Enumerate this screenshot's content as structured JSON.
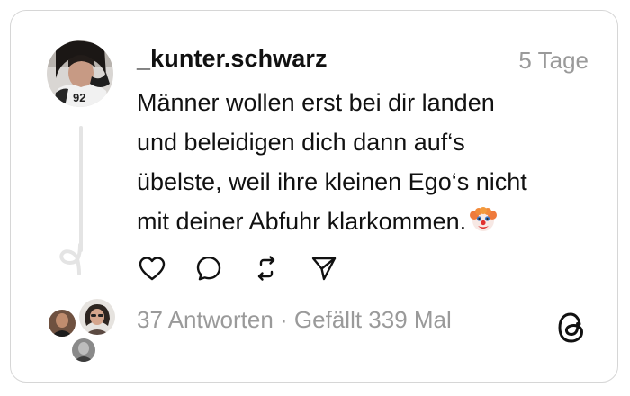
{
  "post": {
    "username": "_kunter.schwarz",
    "timestamp": "5 Tage",
    "text_lines": [
      "Männer wollen erst bei dir landen",
      "und beleidigen dich dann auf‘s",
      "übelste, weil ihre kleinen Ego‘s nicht",
      "mit deiner Abfuhr klarkommen."
    ],
    "emoji": "clown-face-emoji"
  },
  "actions": {
    "like_icon": "heart-icon",
    "comment_icon": "comment-bubble-icon",
    "repost_icon": "repost-arrows-icon",
    "share_icon": "send-paper-plane-icon"
  },
  "footer": {
    "replies": "37 Antworten",
    "separator": "·",
    "likes": "Gefällt 339 Mal",
    "logo_icon": "threads-logo-icon"
  },
  "colors": {
    "text": "#111111",
    "muted": "#9a9a9a",
    "border": "#d6d6d6",
    "thread_line": "#e4e4e4"
  }
}
